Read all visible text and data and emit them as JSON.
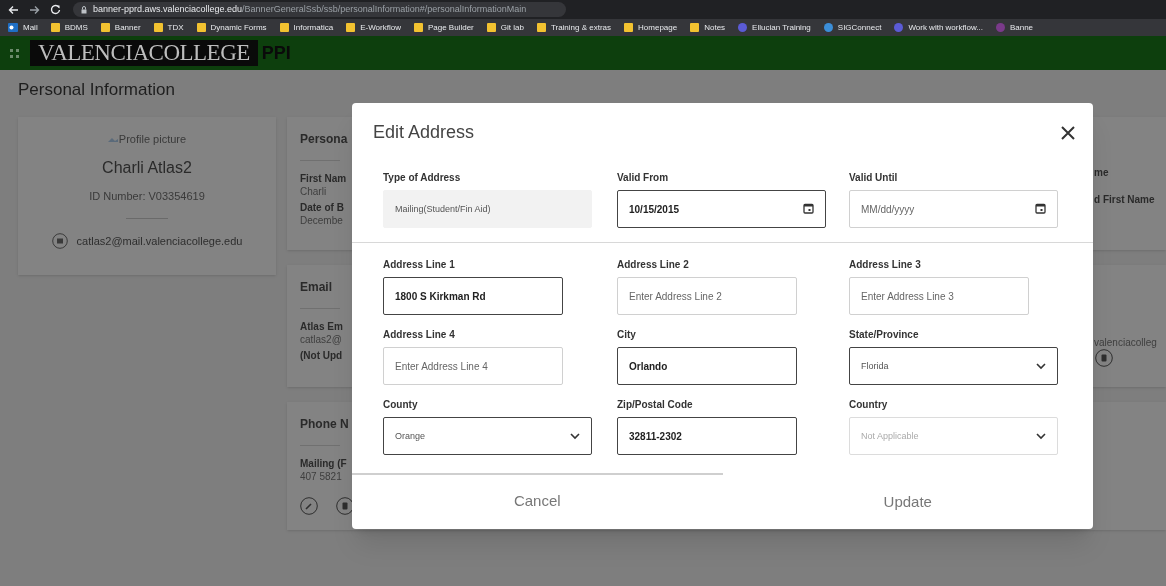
{
  "browser": {
    "url_host": "banner-pprd.aws.valenciacollege.edu",
    "url_path": "/BannerGeneralSsb/ssb/personalInformation#/personalInformationMain",
    "bookmarks": [
      {
        "label": "Mail",
        "kind": "mail"
      },
      {
        "label": "BDMS",
        "kind": "folder"
      },
      {
        "label": "Banner",
        "kind": "folder"
      },
      {
        "label": "TDX",
        "kind": "folder"
      },
      {
        "label": "Dynamic Forms",
        "kind": "folder"
      },
      {
        "label": "Informatica",
        "kind": "folder"
      },
      {
        "label": "E-Workflow",
        "kind": "folder"
      },
      {
        "label": "Page Builder",
        "kind": "folder"
      },
      {
        "label": "Git lab",
        "kind": "folder"
      },
      {
        "label": "Training & extras",
        "kind": "folder"
      },
      {
        "label": "Homepage",
        "kind": "folder"
      },
      {
        "label": "Notes",
        "kind": "folder"
      },
      {
        "label": "Ellucian Training",
        "kind": "site",
        "color": "#5b5bd6"
      },
      {
        "label": "SIGConnect",
        "kind": "site",
        "color": "#3b8ed8"
      },
      {
        "label": "Work with workflow...",
        "kind": "site",
        "color": "#5b5bd6"
      },
      {
        "label": "Banne",
        "kind": "site",
        "color": "#7a3a8a"
      }
    ]
  },
  "header": {
    "logo": "VALENCIACOLLEGE",
    "app": "PPI"
  },
  "page": {
    "title": "Personal Information",
    "profile": {
      "picture_alt": "Profile picture",
      "name": "Charli Atlas2",
      "id_number": "ID Number: V03354619",
      "email": "catlas2@mail.valenciacollege.edu"
    },
    "cards": [
      {
        "title": "Persona",
        "lines": [
          {
            "text": "First Nam",
            "bold": true
          },
          {
            "text": "Charli",
            "bold": false
          },
          {
            "text": "Date of B",
            "bold": true
          },
          {
            "text": "Decembe",
            "bold": false
          }
        ],
        "right_lines": [
          {
            "text": "me",
            "bold": true
          },
          {
            "text": "d First Name",
            "bold": true
          }
        ]
      },
      {
        "title": "Email",
        "lines": [
          {
            "text": "Atlas Em",
            "bold": true
          },
          {
            "text": "catlas2@",
            "bold": false
          },
          {
            "text": "(Not Upd",
            "bold": true
          }
        ],
        "right_lines": [
          {
            "text": "valenciacolleg",
            "bold": false
          }
        ],
        "right_delete_button": true
      },
      {
        "title": "Phone N",
        "lines": [
          {
            "text": "Mailing (F",
            "bold": true
          },
          {
            "text": "407 5821",
            "bold": false
          }
        ],
        "edit_button": true,
        "delete_button": true
      }
    ]
  },
  "dialog": {
    "title": "Edit Address",
    "fields": [
      {
        "label": "Type of Address",
        "kind": "readonly",
        "value": "Mailing(Student/Fin Aid)",
        "disabled": false
      },
      {
        "label": "Valid From",
        "kind": "date",
        "value": "10/15/2015",
        "disabled": false
      },
      {
        "label": "Valid Until",
        "kind": "date",
        "placeholder": "MM/dd/yyyy",
        "disabled": false
      },
      {
        "label": "Address Line 1",
        "kind": "text",
        "value": "1800 S Kirkman Rd",
        "disabled": false
      },
      {
        "label": "Address Line 2",
        "kind": "text",
        "placeholder": "Enter Address Line 2",
        "disabled": false
      },
      {
        "label": "Address Line 3",
        "kind": "text",
        "placeholder": "Enter Address Line 3",
        "disabled": false
      },
      {
        "label": "Address Line 4",
        "kind": "text",
        "placeholder": "Enter Address Line 4",
        "disabled": false
      },
      {
        "label": "City",
        "kind": "text",
        "value": "Orlando",
        "disabled": false
      },
      {
        "label": "State/Province",
        "kind": "select",
        "value": "Florida",
        "disabled": false
      },
      {
        "label": "County",
        "kind": "select",
        "value": "Orange",
        "disabled": false
      },
      {
        "label": "Zip/Postal Code",
        "kind": "text",
        "value": "32811-2302",
        "disabled": false
      },
      {
        "label": "Country",
        "kind": "select",
        "value": "Not Applicable",
        "disabled": true
      }
    ],
    "buttons": [
      "Cancel",
      "Update"
    ]
  }
}
